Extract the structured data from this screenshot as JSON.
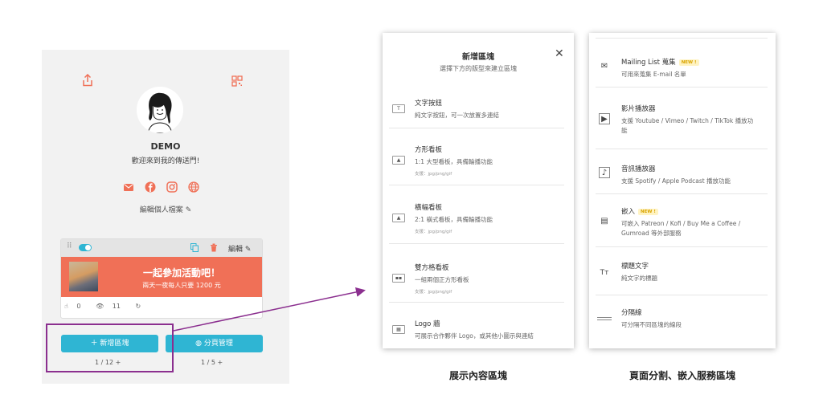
{
  "profile": {
    "name": "DEMO",
    "bio": "歡迎來到我的傳送門!",
    "edit_label": "編輯個人檔案",
    "social_icons": [
      "mail-icon",
      "facebook-icon",
      "instagram-icon",
      "globe-icon"
    ]
  },
  "card": {
    "edit_label": "編輯",
    "title": "一起參加活動吧！",
    "subtitle": "兩天一夜每人只要 1200 元",
    "clicks": "0",
    "views": "11"
  },
  "buttons": {
    "add_block": "＋ 新增區塊",
    "page_manage": "分頁管理"
  },
  "pagers": {
    "left": "1 / 12",
    "right": "1 / 5"
  },
  "mid_panel": {
    "title": "新增區塊",
    "subtitle": "選擇下方的版型來建立區塊",
    "items": [
      {
        "title": "文字按鈕",
        "desc": "純文字按鈕，可一次放置多連結",
        "note": ""
      },
      {
        "title": "方形看板",
        "desc": "1:1 大型看板，具備輪播功能",
        "note": "支援：jpg/png/gif"
      },
      {
        "title": "橫幅看板",
        "desc": "2:1 橫式看板，具備輪播功能",
        "note": "支援：jpg/png/gif"
      },
      {
        "title": "雙方格看板",
        "desc": "一組兩個正方形看板",
        "note": "支援：jpg/png/gif"
      },
      {
        "title": "Logo 牆",
        "desc": "可展示合作夥伴 Logo，或其他小圖示與連結",
        "note": ""
      }
    ]
  },
  "right_panel": {
    "new_badge": "NEW !",
    "items": [
      {
        "title": "Mailing List 蒐集",
        "desc": "可用來蒐集 E-mail 名單",
        "desc2": ""
      },
      {
        "title": "影片播放器",
        "desc": "支援 Youtube / Vimeo / Twitch / TikTok 播放功",
        "desc2": "能"
      },
      {
        "title": "音訊播放器",
        "desc": "支援 Spotify / Apple Podcast 播放功能",
        "desc2": ""
      },
      {
        "title": "嵌入",
        "desc": "可嵌入 Patreon / Kofi / Buy Me a Coffee /",
        "desc2": "Gumroad 等外部服務"
      },
      {
        "title": "標題文字",
        "desc": "純文字的標題",
        "desc2": ""
      },
      {
        "title": "分隔線",
        "desc": "可分隔不同區塊的線段",
        "desc2": ""
      }
    ]
  },
  "captions": {
    "mid": "展示內容區塊",
    "right": "頁面分割、嵌入服務區塊"
  },
  "colors": {
    "accent": "#2fb5d3",
    "coral": "#f07057",
    "highlight": "#8b2f8f"
  }
}
